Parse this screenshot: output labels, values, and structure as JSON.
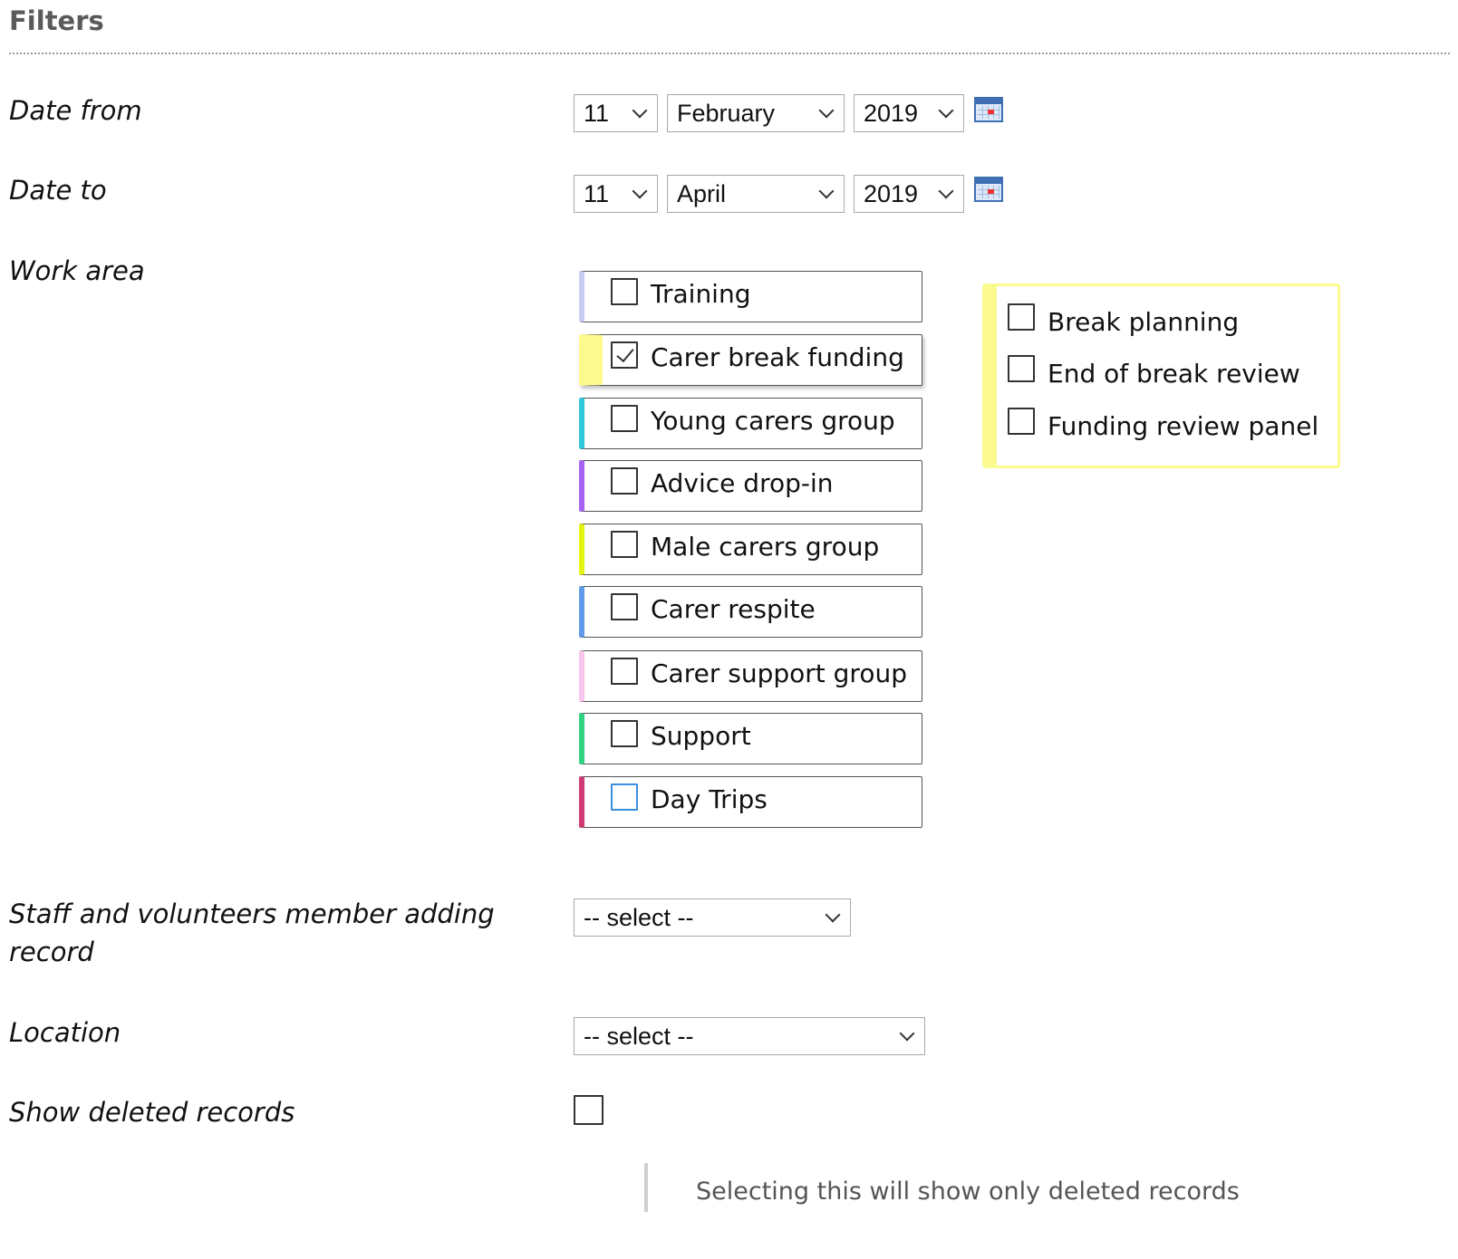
{
  "filters": {
    "heading": "Filters"
  },
  "date_from": {
    "label": "Date from",
    "day": "11",
    "month": "February",
    "year": "2019"
  },
  "date_to": {
    "label": "Date to",
    "day": "11",
    "month": "April",
    "year": "2019"
  },
  "work_area": {
    "label": "Work area",
    "items": [
      {
        "label": "Training",
        "checked": false,
        "color": "#c9cdf4"
      },
      {
        "label": "Carer break funding",
        "checked": true,
        "color": "#fbfa8e"
      },
      {
        "label": "Young carers group",
        "checked": false,
        "color": "#2ec9df"
      },
      {
        "label": "Advice drop-in",
        "checked": false,
        "color": "#a463f2"
      },
      {
        "label": "Male carers group",
        "checked": false,
        "color": "#e3f50d"
      },
      {
        "label": "Carer respite",
        "checked": false,
        "color": "#5f9be8"
      },
      {
        "label": "Carer support group",
        "checked": false,
        "color": "#f6c4ec"
      },
      {
        "label": "Support",
        "checked": false,
        "color": "#2fd382"
      },
      {
        "label": "Day Trips",
        "checked": false,
        "color": "#cf3a72"
      }
    ],
    "sub_options": [
      {
        "label": "Break planning",
        "checked": false
      },
      {
        "label": "End of break review",
        "checked": false
      },
      {
        "label": "Funding review panel",
        "checked": false
      }
    ],
    "sub_panel_color": "#fbfa8e"
  },
  "staff": {
    "label_line1": "Staff and volunteers member adding",
    "label_line2": "record",
    "value": "-- select --"
  },
  "location": {
    "label": "Location",
    "value": "-- select --"
  },
  "show_deleted": {
    "label": "Show deleted records",
    "checked": false,
    "note": "Selecting this will show only deleted records"
  },
  "icons": {
    "calendar": "calendar-icon",
    "dropdown": "chevron-down-icon"
  }
}
